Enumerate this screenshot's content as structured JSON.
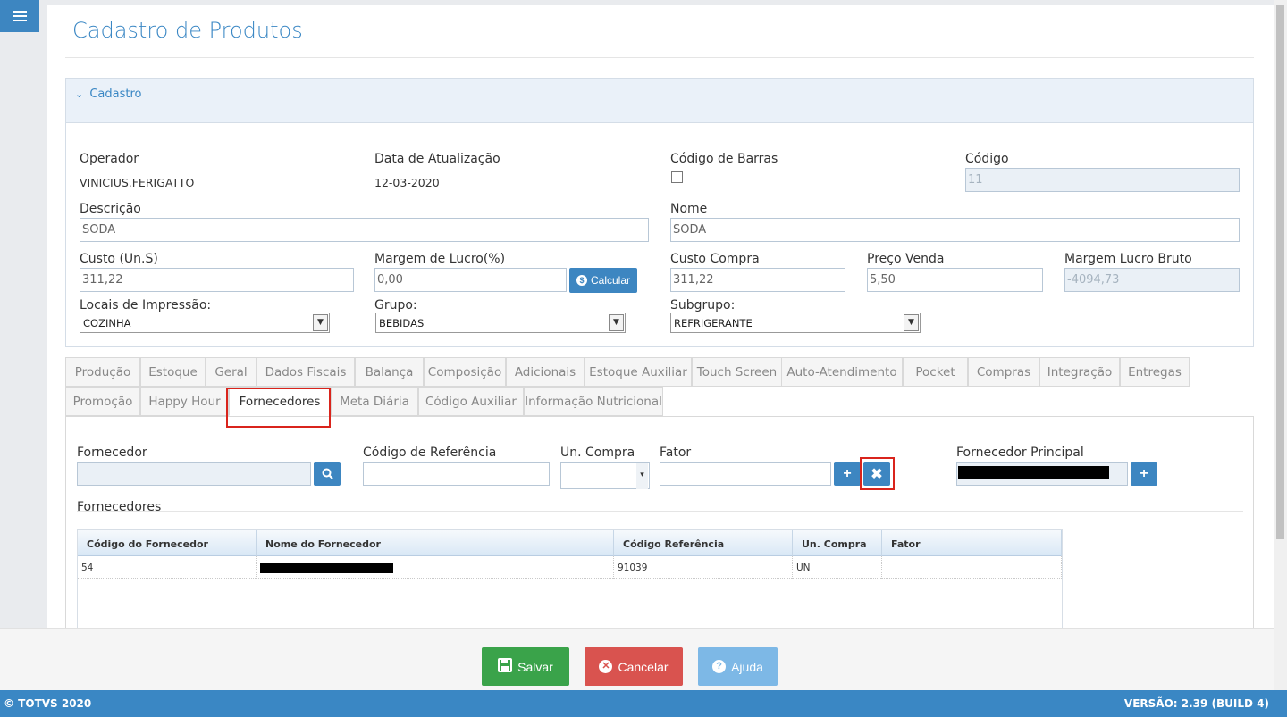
{
  "page": {
    "title": "Cadastro de Produtos"
  },
  "section": {
    "title": "Cadastro"
  },
  "form": {
    "operador_label": "Operador",
    "operador_value": "VINICIUS.FERIGATTO",
    "data_label": "Data de Atualização",
    "data_value": "12-03-2020",
    "codigo_barras_label": "Código de Barras",
    "codigo_label": "Código",
    "codigo_value": "11",
    "descricao_label": "Descrição",
    "descricao_value": "SODA",
    "nome_label": "Nome",
    "nome_value": "SODA",
    "custo_label": "Custo (Un.S)",
    "custo_value": "311,22",
    "margem_label": "Margem de Lucro(%)",
    "margem_value": "0,00",
    "calcular_label": "Calcular",
    "custo_compra_label": "Custo Compra",
    "custo_compra_value": "311,22",
    "preco_label": "Preço Venda",
    "preco_value": "5,50",
    "margem_bruto_label": "Margem Lucro Bruto",
    "margem_bruto_value": "-4094,73",
    "locais_label": "Locais de Impressão:",
    "locais_value": "COZINHA",
    "grupo_label": "Grupo:",
    "grupo_value": "BEBIDAS",
    "subgrupo_label": "Subgrupo:",
    "subgrupo_value": "REFRIGERANTE"
  },
  "tabs_row1": [
    "Produção",
    "Estoque",
    "Geral",
    "Dados Fiscais",
    "Balança",
    "Composição",
    "Adicionais",
    "Estoque Auxiliar",
    "Touch Screen",
    "Auto-Atendimento",
    "Pocket",
    "Compras",
    "Integração",
    "Entregas"
  ],
  "tabs_row2": [
    "Promoção",
    "Happy Hour",
    "Fornecedores",
    "Meta Diária",
    "Código Auxiliar",
    "Informação Nutricional"
  ],
  "active_tab": "Fornecedores",
  "fornecedor_form": {
    "fornecedor_label": "Fornecedor",
    "codigo_ref_label": "Código de Referência",
    "un_compra_label": "Un. Compra",
    "fator_label": "Fator",
    "principal_label": "Fornecedor Principal",
    "list_title": "Fornecedores"
  },
  "grid": {
    "headers": [
      "Código do Fornecedor",
      "Nome do Fornecedor",
      "Código Referência",
      "Un. Compra",
      "Fator"
    ],
    "rows": [
      {
        "codigo": "54",
        "nome": "",
        "ref": "91039",
        "un": "UN",
        "fator": ""
      }
    ]
  },
  "actions": {
    "salvar": "Salvar",
    "cancelar": "Cancelar",
    "ajuda": "Ajuda"
  },
  "status": {
    "left": "© TOTVS 2020",
    "right": "VERSÃO: 2.39 (BUILD 4)"
  },
  "colors": {
    "accent": "#3d86c1",
    "success": "#3aa34a",
    "danger": "#d9534f",
    "info": "#7db8e6",
    "highlight": "#d9241c"
  }
}
